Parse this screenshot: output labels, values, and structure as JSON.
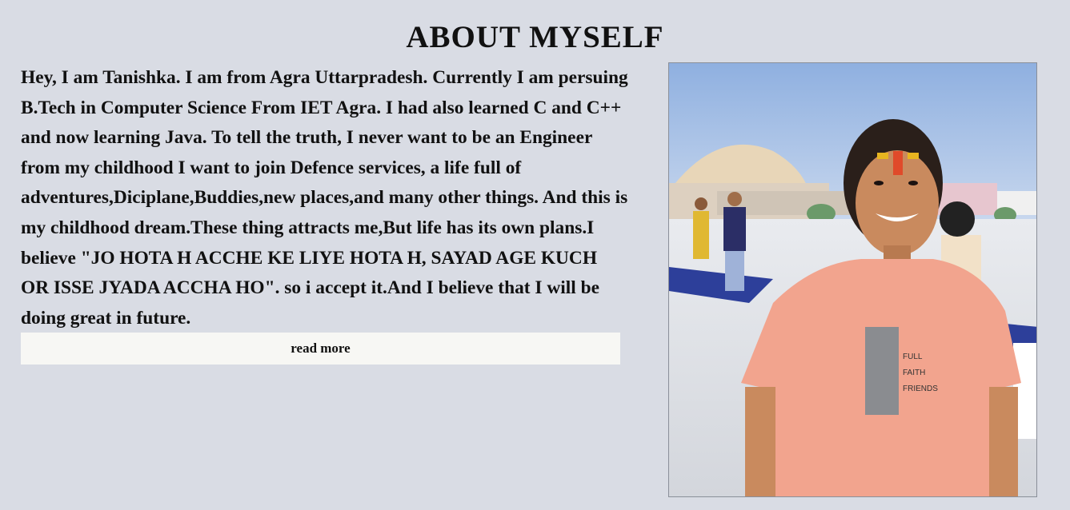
{
  "page": {
    "title": "ABOUT MYSELF"
  },
  "about": {
    "text": "Hey, I am Tanishka. I am from Agra Uttarpradesh. Currently I am persuing B.Tech in Computer Science From IET Agra. I had also learned C and C++ and now learning Java. To tell the truth, I never want to be an Engineer from my childhood I want to join Defence services, a life full of adventures,Diciplane,Buddies,new places,and many other things. And this is my childhood dream.These thing attracts me,But life has its own plans.I believe \"JO HOTA H ACCHE KE LIYE HOTA H, SAYAD AGE KUCH OR ISSE JYADA ACCHA HO\". so i accept it.And I believe that I will be doing great in future.",
    "read_more_label": "read more"
  },
  "photo": {
    "description_icon": "profile-photo",
    "colors": {
      "sky": "#a9c2e6",
      "floor": "#e6e8ec",
      "shirt": "#f2a48e",
      "skin": "#c98a5e"
    }
  }
}
